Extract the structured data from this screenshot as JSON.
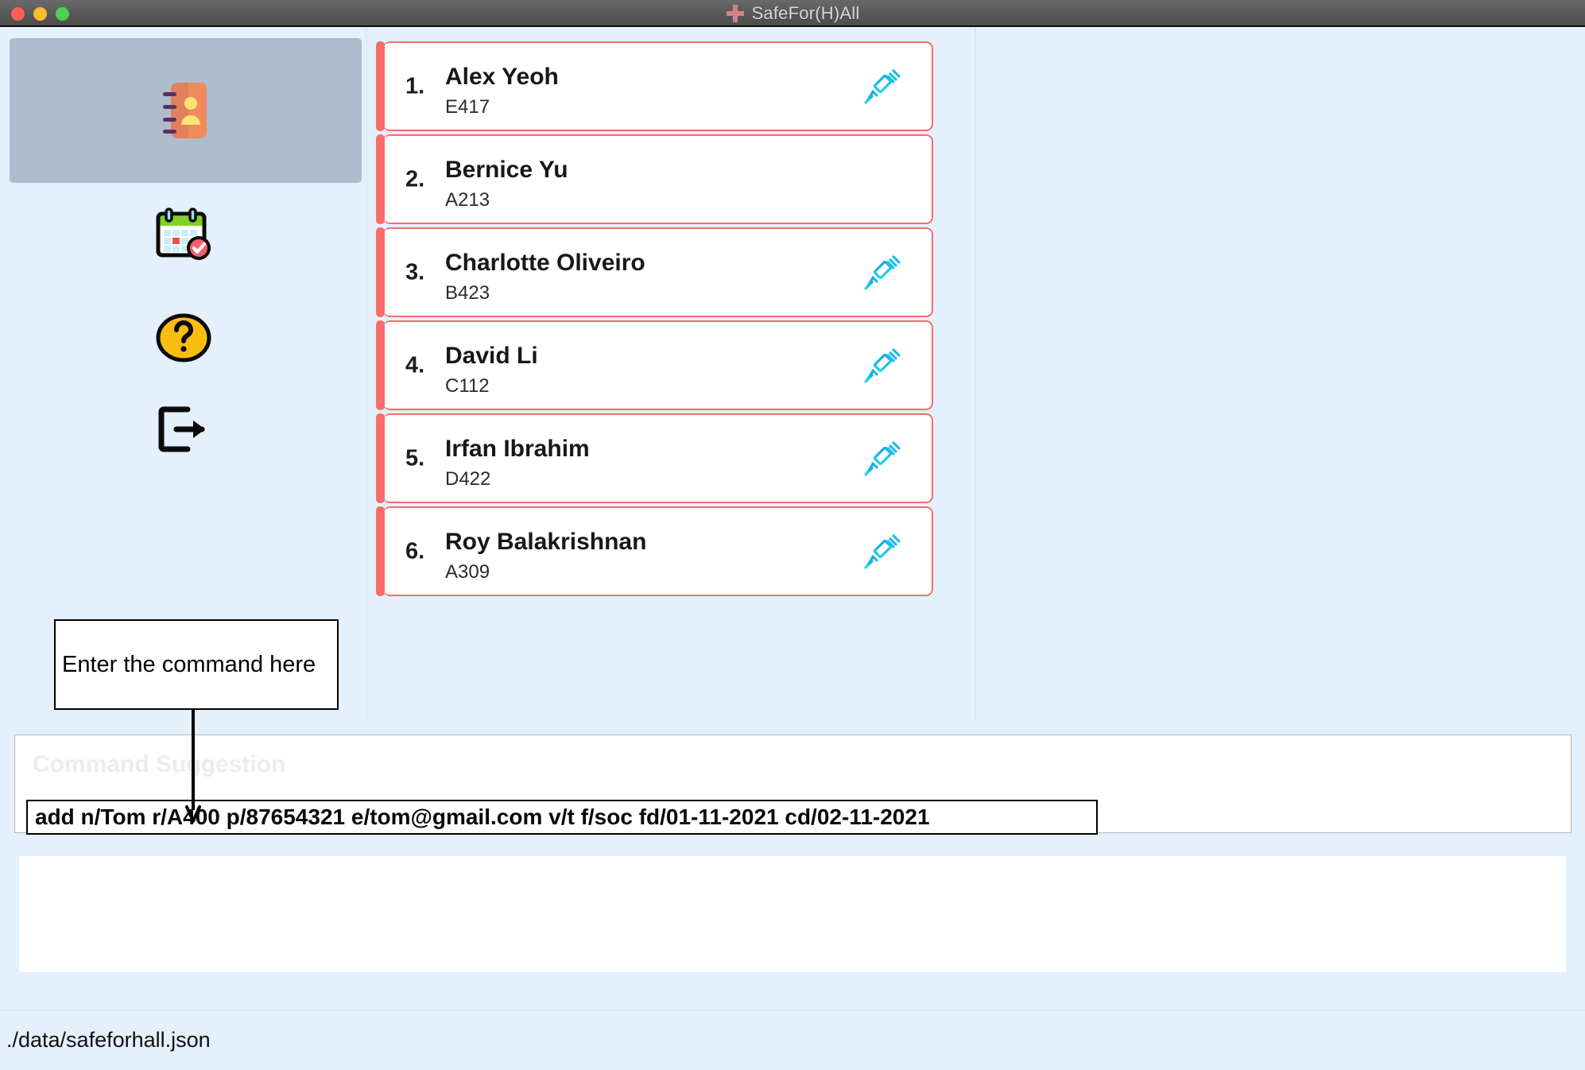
{
  "window": {
    "title": "SafeFor(H)All",
    "logo_icon": "medical-cross-icon",
    "traffic_lights": {
      "close_label": "close",
      "minimize_label": "minimize",
      "maximize_label": "maximize",
      "close_color": "#ff5f57",
      "minimize_color": "#ffbd2e",
      "maximize_color": "#4fd04f"
    },
    "titlebar_color": "#585858",
    "background_color": "#e4f0fc"
  },
  "sidebar": {
    "header_card": {
      "icon": "address-book-icon",
      "background_color": "#adbdcd"
    },
    "items": [
      {
        "icon": "calendar-check-icon",
        "name": "events"
      },
      {
        "icon": "question-mark-circle-icon",
        "name": "help"
      },
      {
        "icon": "logout-arrow-icon",
        "name": "exit"
      }
    ]
  },
  "resident_list": {
    "accent_color": "#fa6b6b",
    "vaccine_icon": "syringe-icon",
    "items": [
      {
        "index": "1.",
        "name": "Alex Yeoh",
        "room": "E417",
        "vaccinated": true
      },
      {
        "index": "2.",
        "name": "Bernice Yu",
        "room": "A213",
        "vaccinated": false
      },
      {
        "index": "3.",
        "name": "Charlotte Oliveiro",
        "room": "B423",
        "vaccinated": true
      },
      {
        "index": "4.",
        "name": "David Li",
        "room": "C112",
        "vaccinated": true
      },
      {
        "index": "5.",
        "name": "Irfan Ibrahim",
        "room": "D422",
        "vaccinated": true
      },
      {
        "index": "6.",
        "name": "Roy Balakrishnan",
        "room": "A309",
        "vaccinated": true
      }
    ]
  },
  "command_area": {
    "suggestion_placeholder": "Command Suggestion",
    "input_value": "add n/Tom r/A400 p/87654321 e/tom@gmail.com v/t f/soc fd/01-11-2021 cd/02-11-2021",
    "result_text": ""
  },
  "annotation": {
    "callout_text": "Enter the command here",
    "arrow_icon": "down-arrow-icon"
  },
  "status_bar": {
    "file_path": "./data/safeforhall.json"
  }
}
